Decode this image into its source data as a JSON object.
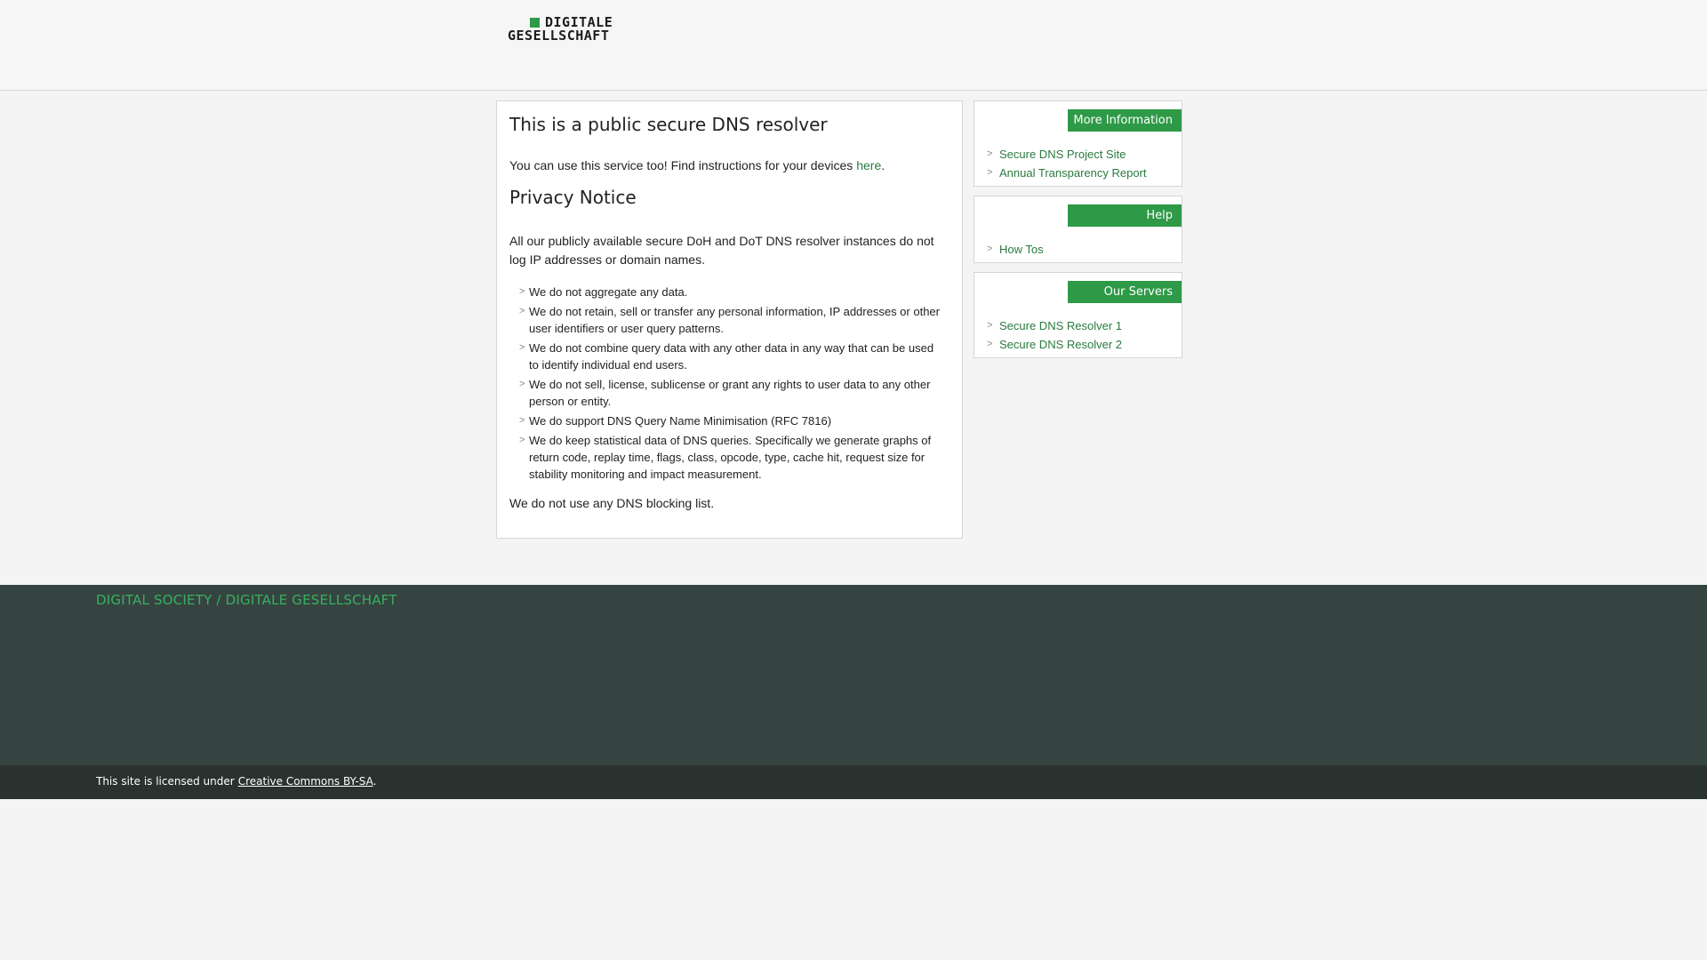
{
  "header": {
    "logo_line1": "DIGITALE",
    "logo_line2": "GESELLSCHAFT",
    "logo_color": "#2e9a47"
  },
  "main": {
    "title": "This is a public secure DNS resolver",
    "intro_text": "You can use this service too! Find instructions for your devices",
    "intro_link": "here",
    "intro_suffix": ".",
    "privacy_title": "Privacy Notice",
    "privacy_intro": "All our publicly available secure DoH and DoT DNS resolver instances do not log IP addresses or domain names.",
    "bullet_marker": ">",
    "bullets": [
      "We do not aggregate any data.",
      "We do not retain, sell or transfer any personal information, IP addresses or other user identifiers or user query patterns.",
      "We do not combine query data with any other data in any way that can be used to identify individual end users.",
      "We do not sell, license, sublicense or grant any rights to user data to any other person or entity.",
      "We do support DNS Query Name Minimisation (RFC 7816)",
      "We do keep statistical data of DNS queries. Specifically we generate graphs of return code, replay time, flags, class, opcode, type, cache hit, request size for stability monitoring and impact measurement."
    ],
    "closing": "We do not use any DNS blocking list."
  },
  "sidebar": {
    "more_info": {
      "header": "More Information",
      "links": [
        "Secure DNS Project Site",
        "Annual Transparency Report"
      ]
    },
    "help": {
      "header": "Help",
      "links": [
        "How Tos"
      ]
    },
    "servers": {
      "header": "Our Servers",
      "links": [
        "Secure DNS Resolver 1",
        "Secure DNS Resolver 2"
      ]
    }
  },
  "footer": {
    "title": "DIGITAL SOCIETY / DIGITALE GESELLSCHAFT",
    "license_text": "This site is licensed under",
    "license_link": "Creative Commons BY-SA",
    "license_suffix": "."
  },
  "colors": {
    "accent": "#2e9a47",
    "link": "#2a7a3e",
    "footer_bg": "#364441",
    "subfooter_bg": "#2a3230"
  }
}
